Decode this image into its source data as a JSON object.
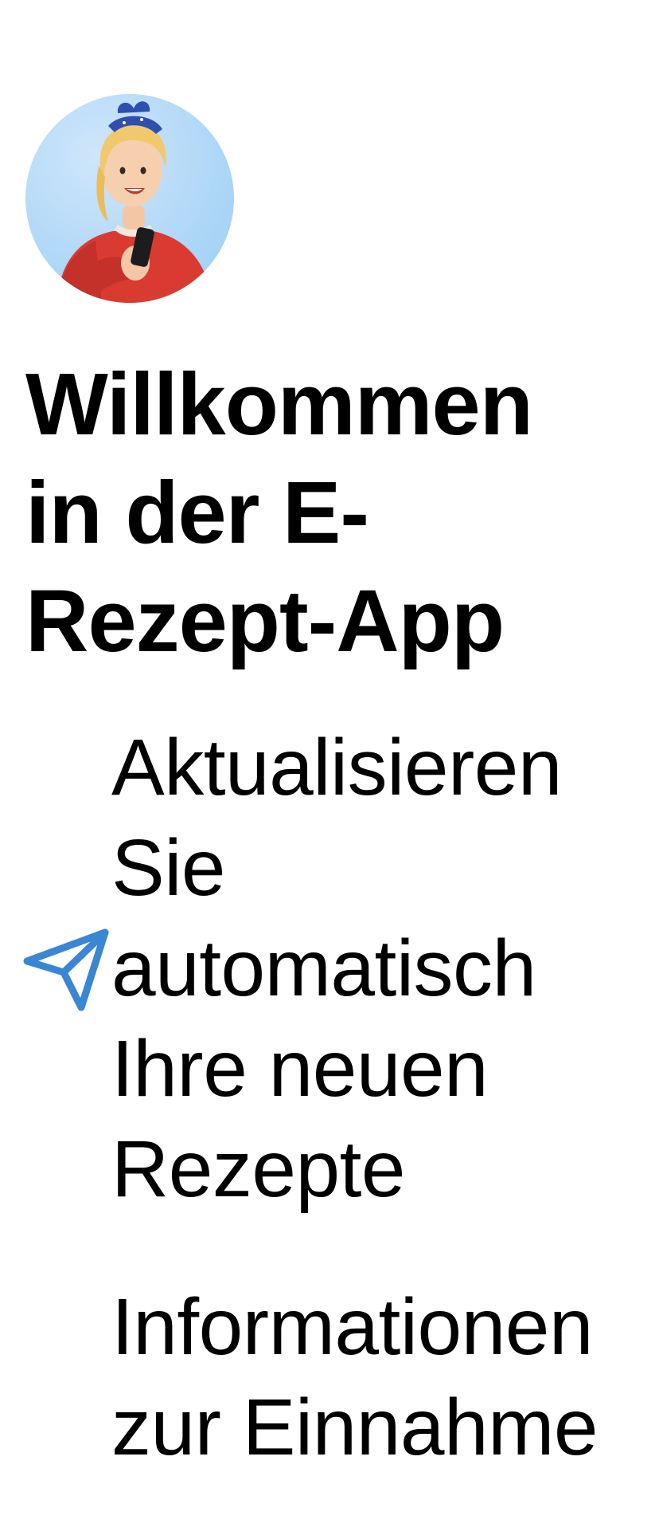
{
  "welcome": {
    "avatar_icon": "woman-with-phone-illustration",
    "title": "Willkommen in der E-Rezept-App"
  },
  "features": [
    {
      "icon": "paper-plane-icon",
      "icon_color": "#3a86d4",
      "text": "Aktualisieren Sie automatisch Ihre neuen Rezepte"
    },
    {
      "icon": "",
      "text": "Informationen zur Einnahme"
    }
  ]
}
